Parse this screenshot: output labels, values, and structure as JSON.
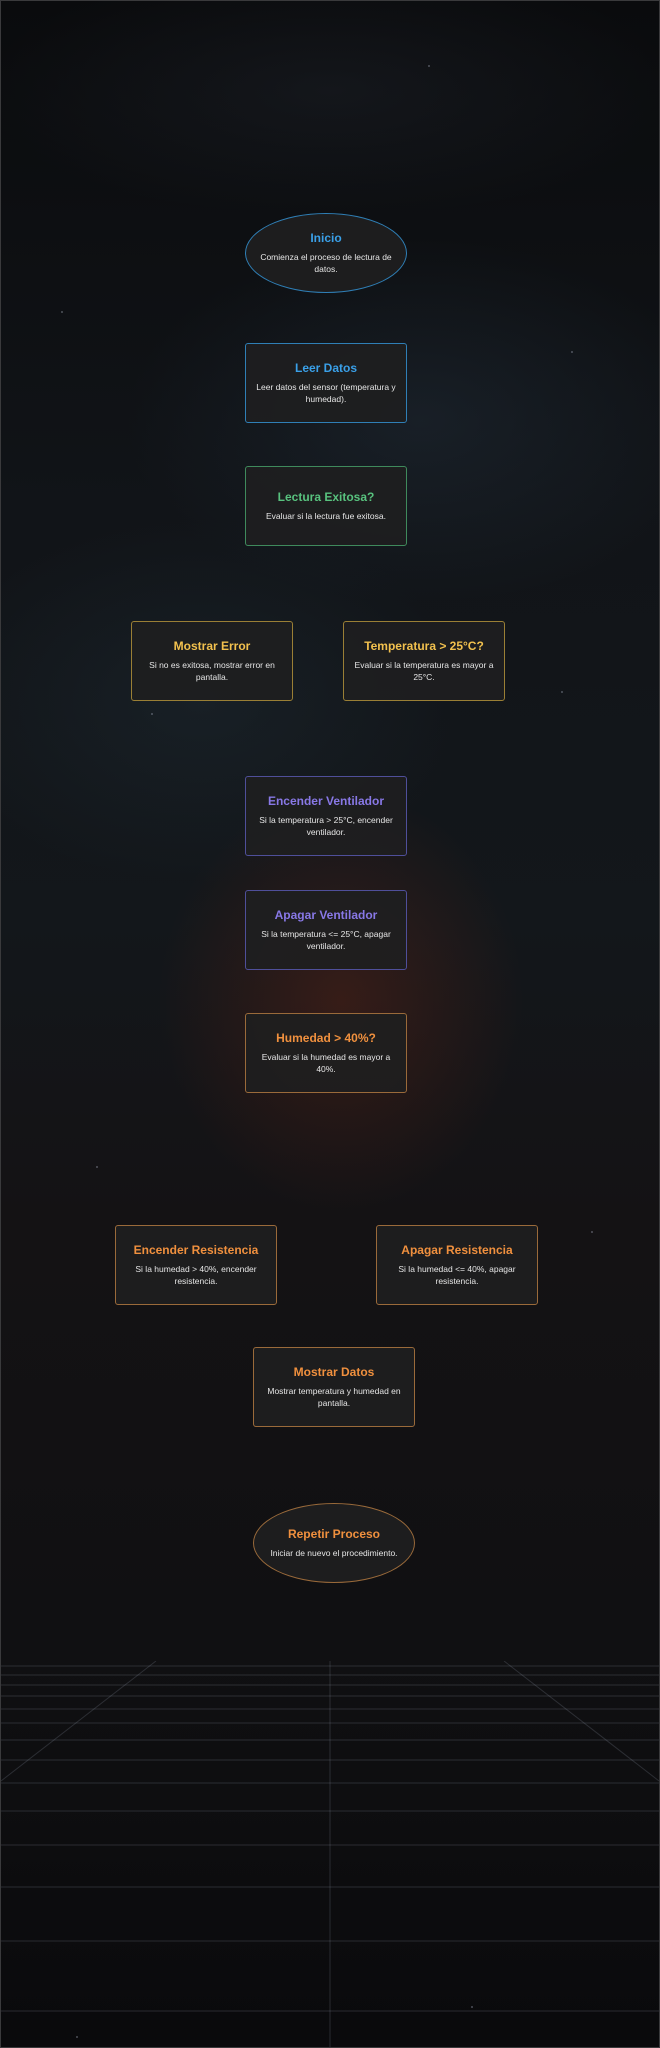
{
  "nodes": {
    "inicio": {
      "title": "Inicio",
      "desc": "Comienza el proceso de lectura de datos."
    },
    "leer_datos": {
      "title": "Leer Datos",
      "desc": "Leer datos del sensor (temperatura y humedad)."
    },
    "lectura_exitosa": {
      "title": "Lectura Exitosa?",
      "desc": "Evaluar si la lectura fue exitosa."
    },
    "mostrar_error": {
      "title": "Mostrar Error",
      "desc": "Si no es exitosa, mostrar error en pantalla."
    },
    "temperatura": {
      "title": "Temperatura > 25°C?",
      "desc": "Evaluar si la temperatura es mayor a 25°C."
    },
    "encender_ventilador": {
      "title": "Encender Ventilador",
      "desc": "Si la temperatura > 25°C, encender ventilador."
    },
    "apagar_ventilador": {
      "title": "Apagar Ventilador",
      "desc": "Si la temperatura <= 25°C, apagar ventilador."
    },
    "humedad": {
      "title": "Humedad > 40%?",
      "desc": "Evaluar si la humedad es mayor a 40%."
    },
    "encender_resistencia": {
      "title": "Encender Resistencia",
      "desc": "Si la humedad > 40%, encender resistencia."
    },
    "apagar_resistencia": {
      "title": "Apagar Resistencia",
      "desc": "Si la humedad <= 40%, apagar resistencia."
    },
    "mostrar_datos": {
      "title": "Mostrar Datos",
      "desc": "Mostrar temperatura y humedad en pantalla."
    },
    "repetir_proceso": {
      "title": "Repetir Proceso",
      "desc": "Iniciar de nuevo el procedimiento."
    }
  },
  "colors": {
    "start": "#3aa0e8",
    "decision": "#58c27e",
    "branch": "#f2c14e",
    "fan": "#8878e6",
    "humidity": "#f0903e"
  }
}
